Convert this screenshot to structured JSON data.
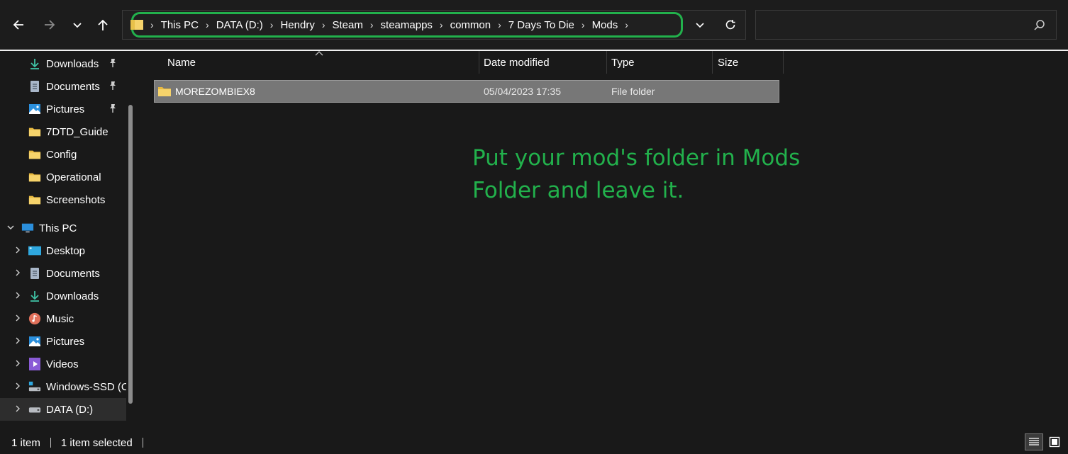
{
  "nav": {
    "back_icon": "arrow-left-icon",
    "forward_icon": "arrow-right-icon",
    "recent_icon": "chevron-down-icon",
    "up_icon": "arrow-up-icon"
  },
  "address_bar": {
    "crumbs": [
      "This PC",
      "DATA (D:)",
      "Hendry",
      "Steam",
      "steamapps",
      "common",
      "7 Days To Die",
      "Mods"
    ],
    "highlight_color": "#22b14c"
  },
  "search": {
    "placeholder": ""
  },
  "sidebar": {
    "quick_access": [
      {
        "label": "Downloads",
        "icon": "download-icon",
        "pinned": true
      },
      {
        "label": "Documents",
        "icon": "document-icon",
        "pinned": true
      },
      {
        "label": "Pictures",
        "icon": "pictures-icon",
        "pinned": true
      },
      {
        "label": "7DTD_Guide",
        "icon": "folder-icon",
        "pinned": false
      },
      {
        "label": "Config",
        "icon": "folder-icon",
        "pinned": false
      },
      {
        "label": "Operational",
        "icon": "folder-icon",
        "pinned": false
      },
      {
        "label": "Screenshots",
        "icon": "folder-icon",
        "pinned": false
      }
    ],
    "this_pc": {
      "label": "This PC",
      "icon": "computer-icon",
      "expanded": true
    },
    "this_pc_items": [
      {
        "label": "Desktop",
        "icon": "desktop-icon"
      },
      {
        "label": "Documents",
        "icon": "document-icon"
      },
      {
        "label": "Downloads",
        "icon": "download-icon"
      },
      {
        "label": "Music",
        "icon": "music-icon"
      },
      {
        "label": "Pictures",
        "icon": "pictures-icon"
      },
      {
        "label": "Videos",
        "icon": "video-icon"
      },
      {
        "label": "Windows-SSD (C",
        "icon": "drive-c-icon"
      },
      {
        "label": "DATA (D:)",
        "icon": "drive-icon",
        "selected": true
      }
    ]
  },
  "columns": {
    "name": "Name",
    "date": "Date modified",
    "type": "Type",
    "size": "Size"
  },
  "files": [
    {
      "name": "MOREZOMBIEX8",
      "date": "05/04/2023 17:35",
      "type": "File folder",
      "size": "",
      "selected": true
    }
  ],
  "annotation": {
    "text": "Put your mod's folder in Mods Folder and leave it.",
    "color": "#22b14c"
  },
  "status": {
    "count": "1 item",
    "selected": "1 item selected"
  },
  "colors": {
    "background": "#191919",
    "folder": "#f6d36b",
    "selection": "#777777"
  }
}
